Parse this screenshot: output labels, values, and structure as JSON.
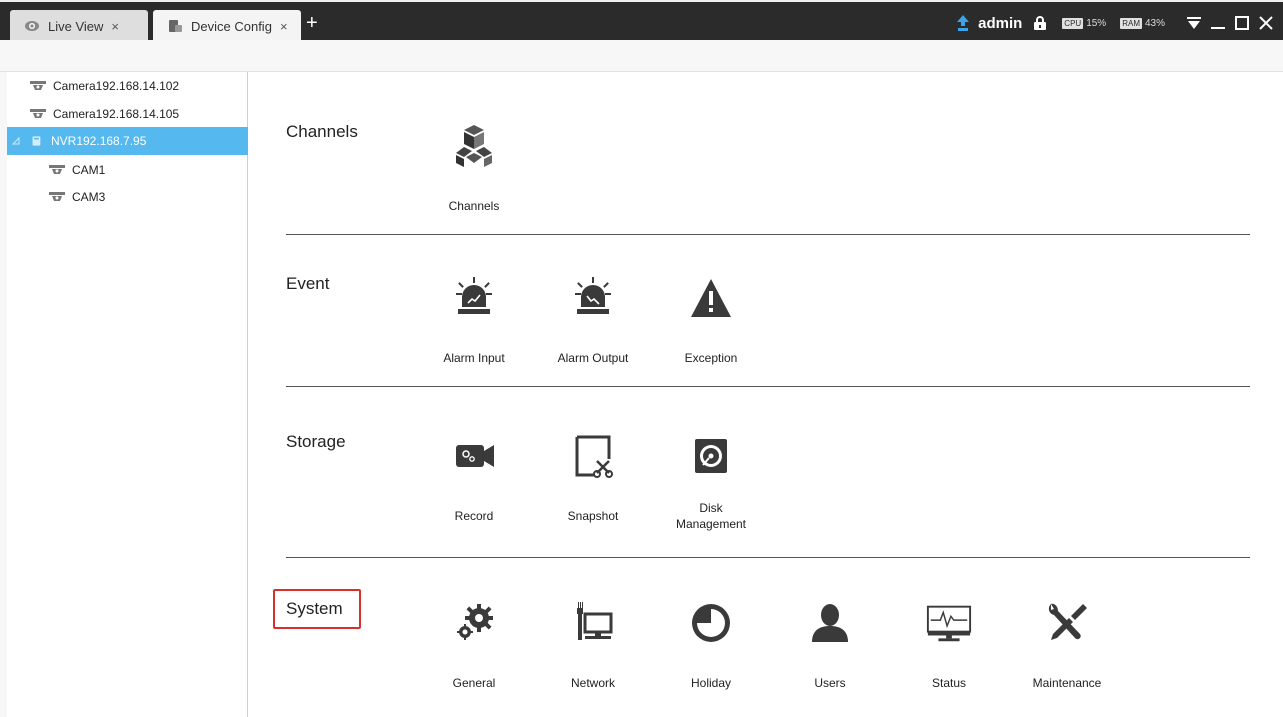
{
  "tabs": [
    {
      "label": "Live View",
      "close": "×"
    },
    {
      "label": "Device Config",
      "close": "×"
    }
  ],
  "new_tab": "+",
  "status": {
    "user": "admin",
    "cpu_label": "CPU",
    "cpu_value": "15%",
    "ram_label": "RAM",
    "ram_value": "43%"
  },
  "devices": [
    {
      "label": "Camera192.168.14.102"
    },
    {
      "label": "Camera192.168.14.105"
    },
    {
      "label": "NVR192.168.7.95"
    },
    {
      "label": "CAM1"
    },
    {
      "label": "CAM3"
    }
  ],
  "sections": {
    "channels": {
      "title": "Channels",
      "items": [
        "Channels"
      ]
    },
    "event": {
      "title": "Event",
      "items": [
        "Alarm Input",
        "Alarm Output",
        "Exception"
      ]
    },
    "storage": {
      "title": "Storage",
      "items": [
        "Record",
        "Snapshot",
        "Disk",
        "Management"
      ]
    },
    "system": {
      "title": "System",
      "items": [
        "General",
        "Network",
        "Holiday",
        "Users",
        "Status",
        "Maintenance"
      ]
    }
  },
  "colors": {
    "accent": "#55b8ef",
    "highlight": "#d9302b",
    "icon": "#3a3a3a"
  }
}
